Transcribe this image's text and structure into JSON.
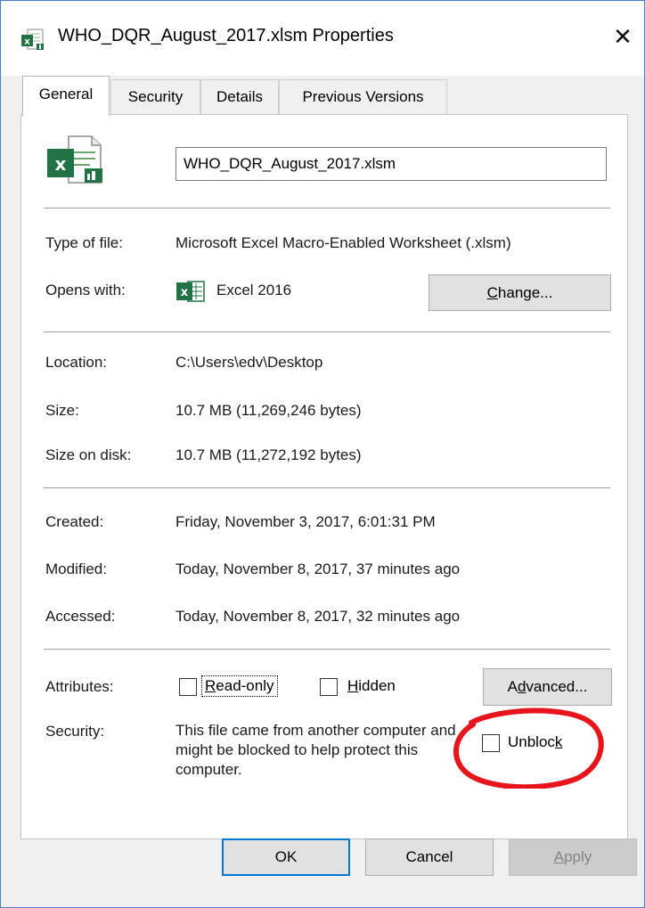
{
  "window": {
    "title": "WHO_DQR_August_2017.xlsm Properties",
    "close_glyph": "✕"
  },
  "tabs": [
    {
      "label": "General",
      "active": true
    },
    {
      "label": "Security",
      "active": false
    },
    {
      "label": "Details",
      "active": false
    },
    {
      "label": "Previous Versions",
      "active": false
    }
  ],
  "general": {
    "file_name": "WHO_DQR_August_2017.xlsm",
    "type_label": "Type of file:",
    "type_value": "Microsoft Excel Macro-Enabled Worksheet (.xlsm)",
    "opens_label": "Opens with:",
    "opens_value": "Excel 2016",
    "change_button_pre": "",
    "change_button_key": "C",
    "change_button_post": "hange...",
    "location_label": "Location:",
    "location_value": "C:\\Users\\edv\\Desktop",
    "size_label": "Size:",
    "size_value": "10.7 MB (11,269,246 bytes)",
    "size_disk_label": "Size on disk:",
    "size_disk_value": "10.7 MB (11,272,192 bytes)",
    "created_label": "Created:",
    "created_value": "Friday, November 3, 2017, 6:01:31 PM",
    "modified_label": "Modified:",
    "modified_value": "Today, November 8, 2017, 37 minutes ago",
    "accessed_label": "Accessed:",
    "accessed_value": "Today, November 8, 2017, 32 minutes ago",
    "attributes_label": "Attributes:",
    "readonly_key": "R",
    "readonly_rest": "ead-only",
    "hidden_key": "H",
    "hidden_rest": "idden",
    "advanced_pre": "A",
    "advanced_key": "d",
    "advanced_post": "vanced...",
    "security_label": "Security:",
    "security_text": "This file came from another computer and might be blocked to help protect this computer.",
    "unblock_pre": "Unbloc",
    "unblock_key": "k",
    "unblock_post": ""
  },
  "footer": {
    "ok": "OK",
    "cancel": "Cancel",
    "apply_key": "A",
    "apply_rest": "pply"
  },
  "colors": {
    "window_border": "#4a7fc1",
    "dialog_bg": "#f0f0f0",
    "annotation_red": "#e8141c",
    "excel_green": "#217346"
  }
}
